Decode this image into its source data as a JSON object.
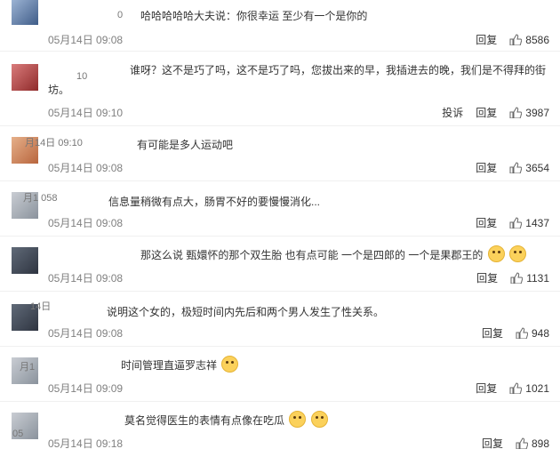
{
  "comments": [
    {
      "text": "哈哈哈哈哈大夫说：你很幸运 至少有一个是你的",
      "date": "05月14日 09:08",
      "reply": "回复",
      "likes": "8586",
      "user_fragment": "0"
    },
    {
      "text": "谁呀？这不是巧了吗，这不是巧了吗，您拔出来的早，我插进去的晚，我们是不得拜的街坊。",
      "date": "05月14日 09:10",
      "reply": "回复",
      "report": "投诉",
      "likes": "3987",
      "user_fragment": "10"
    },
    {
      "text": "有可能是多人运动吧",
      "date": "05月14日 09:08",
      "reply": "回复",
      "likes": "3654",
      "user_fragment": "月14日 09:10"
    },
    {
      "text": "信息量稍微有点大，肠胃不好的要慢慢消化...",
      "date": "05月14日 09:08",
      "reply": "回复",
      "likes": "1437",
      "user_fragment": "月1 058"
    },
    {
      "text": "那这么说 甄嬛怀的那个双生胎 也有点可能 一个是四郎的 一个是果郡王的",
      "date": "05月14日 09:08",
      "reply": "回复",
      "likes": "1131",
      "user_fragment": ""
    },
    {
      "text": "说明这个女的，极短时间内先后和两个男人发生了性关系。",
      "date": "05月14日 09:08",
      "reply": "回复",
      "likes": "948",
      "user_fragment": "14日"
    },
    {
      "text": "时间管理直逼罗志祥",
      "date": "05月14日 09:09",
      "reply": "回复",
      "likes": "1021",
      "user_fragment": "月1"
    },
    {
      "text": "莫名觉得医生的表情有点像在吃瓜",
      "date": "05月14日 09:18",
      "reply": "回复",
      "likes": "898",
      "user_fragment": "05"
    }
  ]
}
